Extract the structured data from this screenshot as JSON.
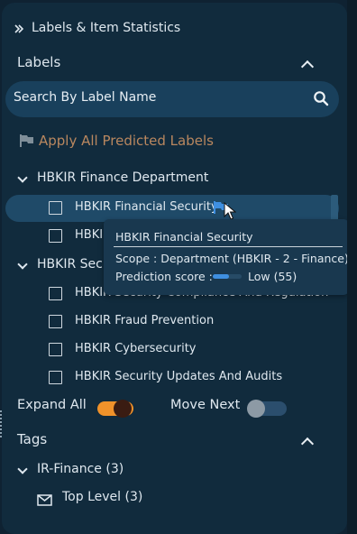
{
  "header": {
    "title": "Labels & Item Statistics"
  },
  "labels_section": {
    "title": "Labels"
  },
  "search": {
    "placeholder": "Search By Label Name"
  },
  "apply_predicted": {
    "label": "Apply All Predicted Labels",
    "color": "#b9875f"
  },
  "groups": [
    {
      "name": "HBKIR Finance Department",
      "items": [
        "HBKIR Financial Security",
        "HBKI"
      ]
    },
    {
      "name": "HBKIR Secu",
      "items": [
        "HBKIR Security Compliance And Regulation",
        "HBKIR Fraud Prevention",
        "HBKIR Cybersecurity",
        "HBKIR Security Updates And Audits"
      ]
    }
  ],
  "tooltip": {
    "title": "HBKIR Financial Security",
    "scope": "Scope : Department (HBKIR - 2 - Finance)",
    "prediction_label": "Prediction score :",
    "prediction_value": "Low (55)",
    "prediction_fraction": 0.55
  },
  "controls": {
    "expand_all": {
      "label": "Expand All",
      "on": true,
      "color": "#f0922a"
    },
    "move_next": {
      "label": "Move Next",
      "on": false
    }
  },
  "tags_section": {
    "title": "Tags",
    "group": "IR-Finance (3)",
    "item": "Top Level (3)"
  },
  "icons": [
    "double-chevron-right-icon",
    "chevron-up-icon",
    "search-icon",
    "flag-icon",
    "chevron-down-icon",
    "flag-icon-blue",
    "mouse-cursor-icon",
    "envelope-icon"
  ]
}
